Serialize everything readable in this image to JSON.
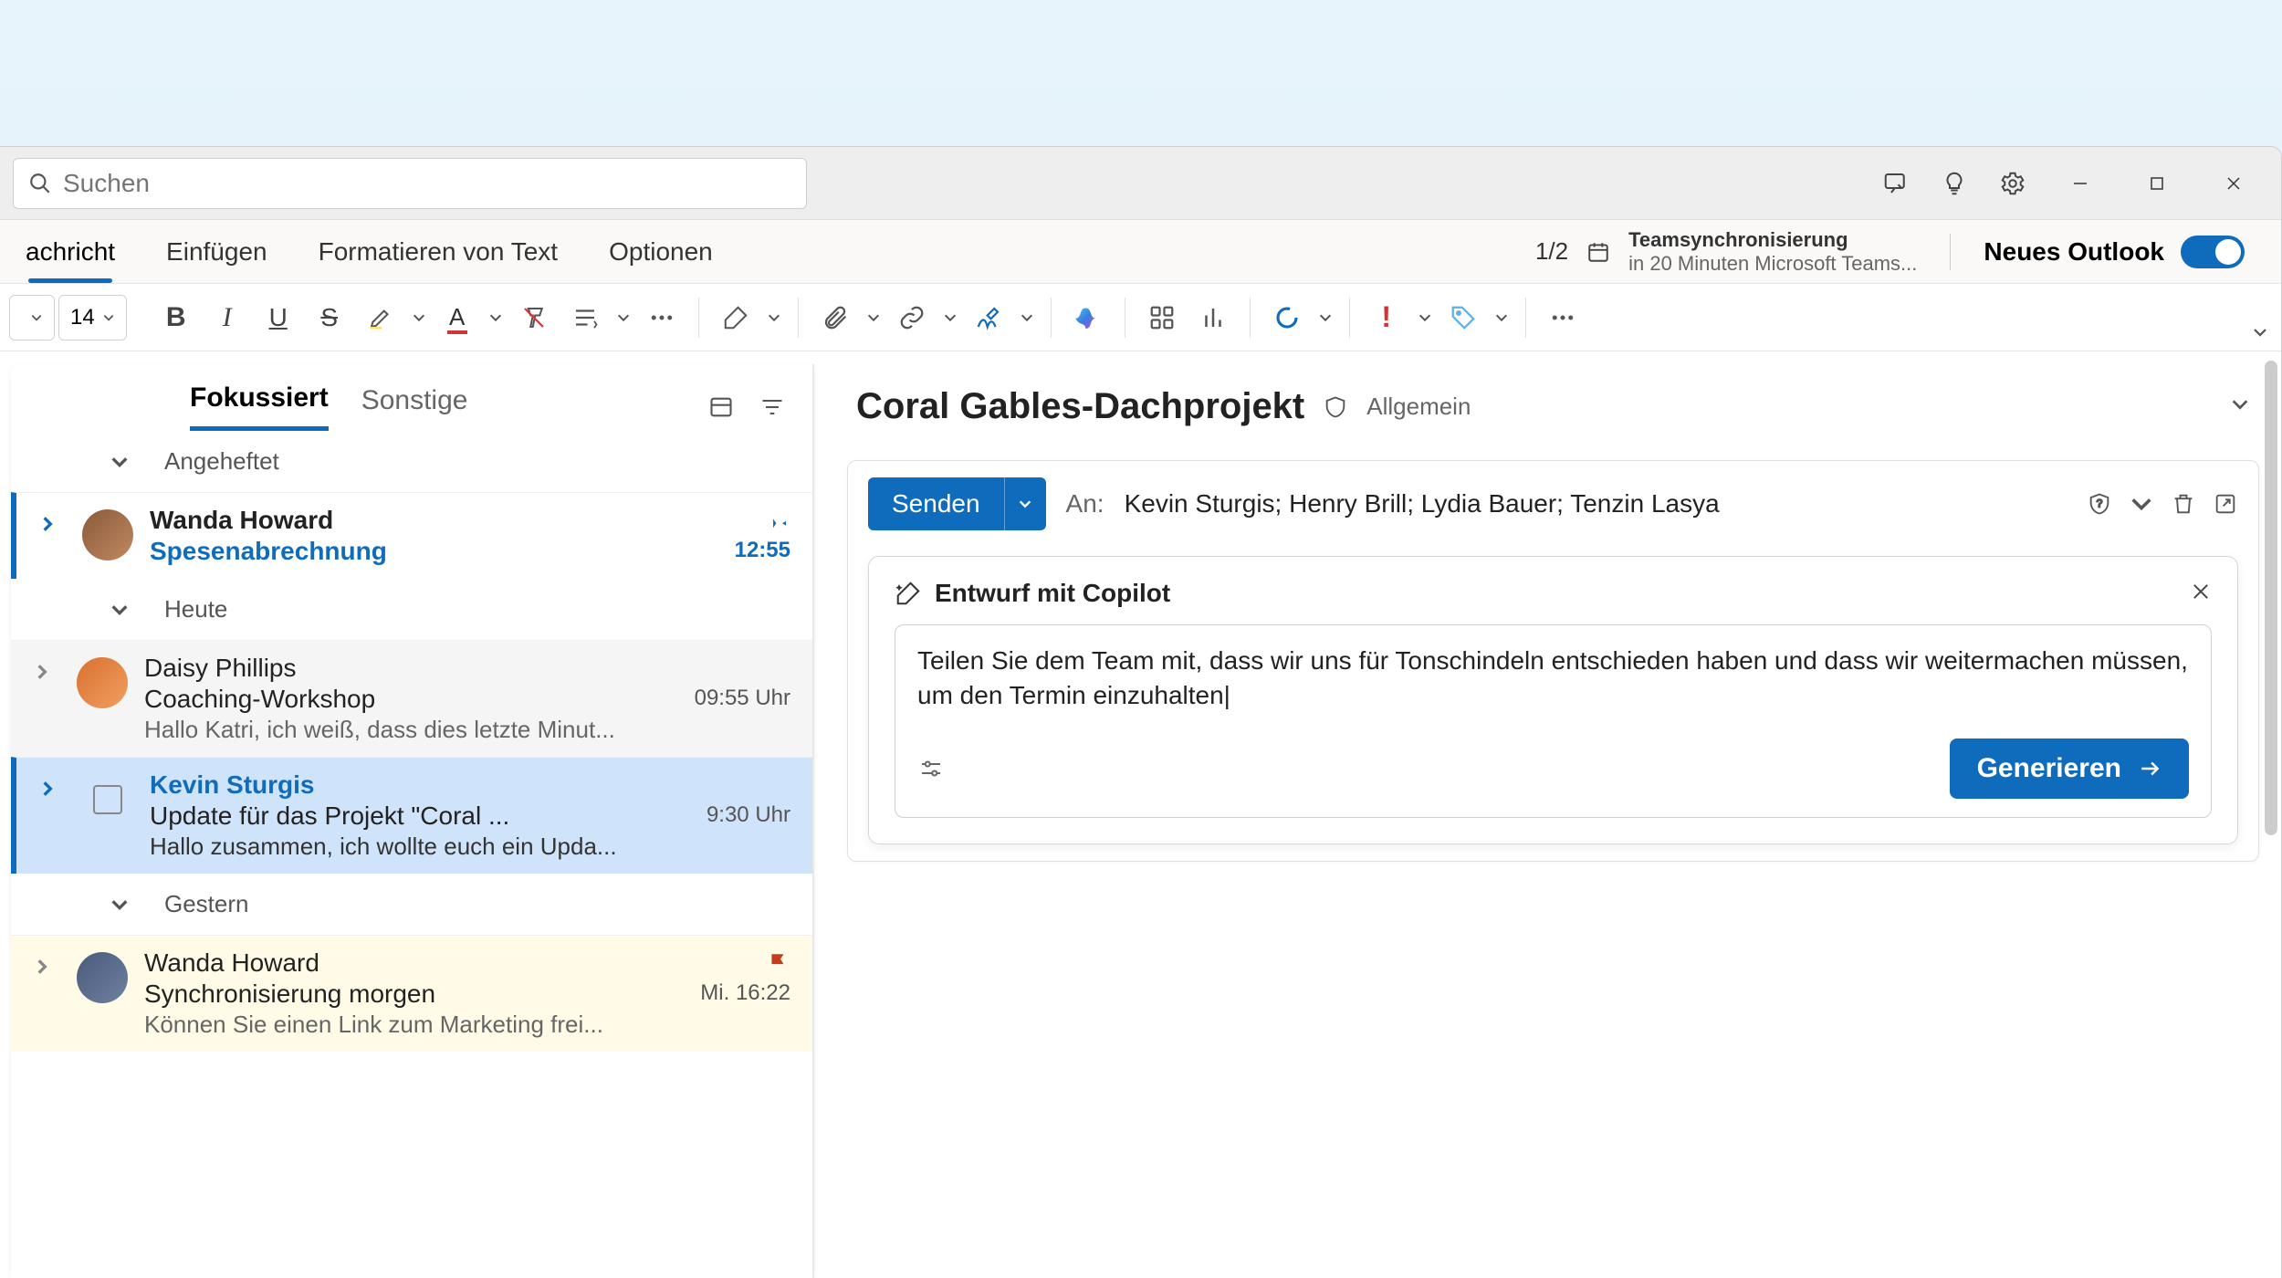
{
  "search": {
    "placeholder": "Suchen"
  },
  "menu": {
    "tabs": [
      "achricht",
      "Einfügen",
      "Formatieren von Text",
      "Optionen"
    ],
    "counter": "1/2",
    "calendar": {
      "title": "Teamsynchronisierung",
      "subtitle": "in 20 Minuten Microsoft Teams..."
    },
    "new_outlook": "Neues Outlook"
  },
  "ribbon": {
    "font_size": "14"
  },
  "list": {
    "tabs": {
      "focused": "Fokussiert",
      "other": "Sonstige"
    },
    "groups": {
      "pinned": "Angeheftet",
      "today": "Heute",
      "yesterday": "Gestern"
    },
    "items": [
      {
        "sender": "Wanda Howard",
        "subject": "Spesenabrechnung",
        "time": "12:55"
      },
      {
        "sender": "Daisy Phillips",
        "subject": "Coaching-Workshop",
        "time": "09:55 Uhr",
        "preview": "Hallo Katri, ich weiß, dass dies letzte Minut..."
      },
      {
        "sender": "Kevin Sturgis",
        "subject": "Update für das Projekt \"Coral ...",
        "time": "9:30 Uhr",
        "preview": "Hallo zusammen, ich wollte euch ein Upda..."
      },
      {
        "sender": "Wanda Howard",
        "subject": "Synchronisierung morgen",
        "time": "Mi. 16:22",
        "preview": "Können Sie einen Link zum Marketing frei..."
      }
    ]
  },
  "reading": {
    "subject": "Coral Gables-Dachprojekt",
    "tag": "Allgemein",
    "send": "Senden",
    "to_label": "An:",
    "to_names": "Kevin Sturgis; Henry Brill; Lydia Bauer; Tenzin Lasya",
    "copilot": {
      "title": "Entwurf mit Copilot",
      "prompt": "Teilen Sie dem Team mit, dass wir uns für Tonschindeln entschieden haben und dass wir weitermachen müssen, um den Termin einzuhalten|",
      "generate": "Generieren"
    }
  }
}
